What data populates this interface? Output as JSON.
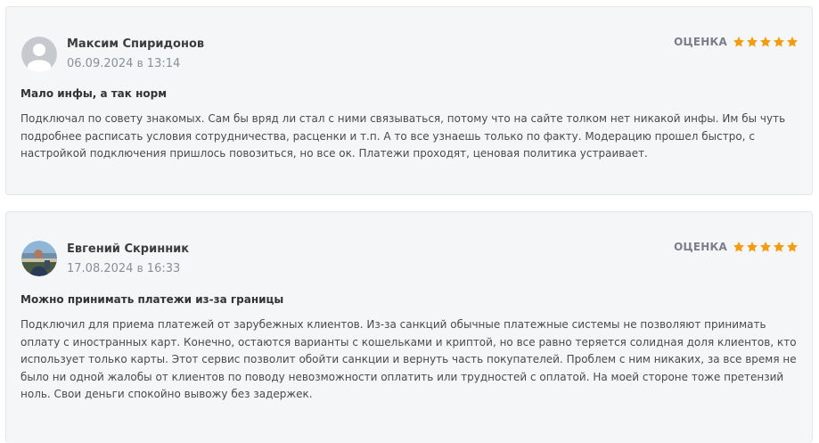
{
  "reviews": [
    {
      "author": "Максим Спиридонов",
      "date": "06.09.2024",
      "date_sep": "в",
      "time": "13:14",
      "rating_label": "ОЦЕНКА",
      "rating": 5,
      "title": "Мало инфы, а так норм",
      "text": "Подключал по совету знакомых. Сам бы вряд ли стал с ними связываться, потому что на сайте толком нет никакой инфы. Им бы чуть подробнее расписать условия сотрудничества, расценки и т.п. А то все узнаешь только по факту. Модерацию прошел быстро, с настройкой подключения пришлось повозиться, но все ок. Платежи проходят, ценовая политика устраивает.",
      "avatar": "default-user-avatar"
    },
    {
      "author": "Евгений Скринник",
      "date": "17.08.2024",
      "date_sep": "в",
      "time": "16:33",
      "rating_label": "ОЦЕНКА",
      "rating": 5,
      "title": "Можно принимать платежи из-за границы",
      "text": "Подключил для приема платежей от зарубежных клиентов. Из-за санкций обычные платежные системы не позволяют принимать оплату с иностранных карт. Конечно, остаются варианты с кошельками и криптой, но все равно теряется солидная доля клиентов, кто использует только карты. Этот сервис позволит обойти санкции и вернуть часть покупателей. Проблем с ним никаких, за все время не было ни одной жалобы от клиентов по поводу невозможности оплатить или трудностей с оплатой. На моей стороне тоже претензий ноль. Свои деньги спокойно вывожу без задержек.",
      "avatar": "user-photo-avatar"
    }
  ],
  "colors": {
    "card_bg": "#f5f6f8",
    "star": "#f39c12",
    "muted": "#8a8f97"
  }
}
